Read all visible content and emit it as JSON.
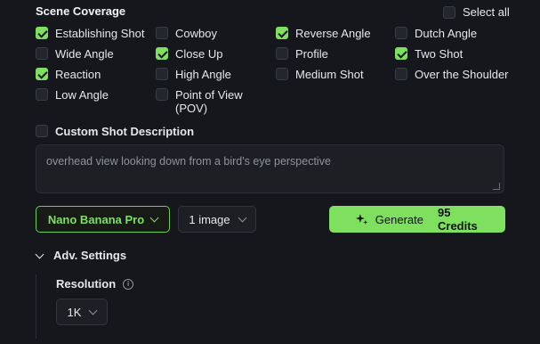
{
  "section_title": "Scene Coverage",
  "select_all": {
    "label": "Select all",
    "checked": false
  },
  "shots": [
    {
      "label": "Establishing Shot",
      "checked": true
    },
    {
      "label": "Cowboy",
      "checked": false
    },
    {
      "label": "Reverse Angle",
      "checked": true
    },
    {
      "label": "Dutch Angle",
      "checked": false
    },
    {
      "label": "Wide Angle",
      "checked": false
    },
    {
      "label": "Close Up",
      "checked": true
    },
    {
      "label": "Profile",
      "checked": false
    },
    {
      "label": "Two Shot",
      "checked": true
    },
    {
      "label": "Reaction",
      "checked": true
    },
    {
      "label": "High Angle",
      "checked": false
    },
    {
      "label": "Medium Shot",
      "checked": false
    },
    {
      "label": "Over the Shoulder",
      "checked": false
    },
    {
      "label": "Low Angle",
      "checked": false
    },
    {
      "label": "Point of View (POV)",
      "checked": false
    }
  ],
  "custom_shot": {
    "label": "Custom Shot Description",
    "checked": false
  },
  "description": {
    "value": "overhead view looking down from a bird's eye perspective"
  },
  "model_select": {
    "value": "Nano Banana Pro"
  },
  "count_select": {
    "value": "1 image"
  },
  "generate": {
    "label": "Generate",
    "credits": "95 Credits"
  },
  "advanced": {
    "label": "Adv. Settings",
    "expanded": true
  },
  "resolution": {
    "label": "Resolution",
    "value": "1K"
  },
  "colors": {
    "accent": "#7ee05e",
    "background": "#16171c"
  }
}
